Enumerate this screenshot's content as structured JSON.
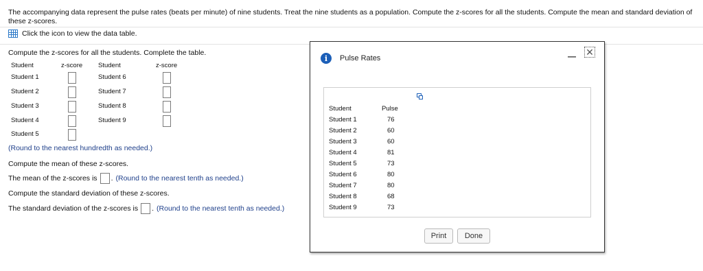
{
  "question": {
    "prompt": "The accompanying data represent the pulse rates (beats per minute) of nine students. Treat the nine students as a population. Compute the z-scores for all the students. Compute the mean and standard deviation of these z-scores.",
    "icon_link": "Click the icon to view the data table."
  },
  "part_a": {
    "instruction": "Compute the z-scores for all the students. Complete the table.",
    "headers": [
      "Student",
      "z-score",
      "Student",
      "z-score"
    ],
    "left_rows": [
      "Student 1",
      "Student 2",
      "Student 3",
      "Student 4",
      "Student 5"
    ],
    "right_rows": [
      "Student 6",
      "Student 7",
      "Student 8",
      "Student 9"
    ],
    "round_note": "(Round to the nearest hundredth as needed.)"
  },
  "part_b": {
    "instruction": "Compute the mean of these z-scores.",
    "sentence": "The mean of the z-scores is",
    "round_note": "(Round to the nearest tenth as needed.)"
  },
  "part_c": {
    "instruction": "Compute the standard deviation of these z-scores.",
    "sentence": "The standard deviation of the z-scores is",
    "round_note": "(Round to the nearest tenth as needed.)"
  },
  "modal": {
    "title": "Pulse Rates",
    "info_glyph": "i",
    "minimize_glyph": "—",
    "close_glyph": "✕",
    "table": {
      "headers": [
        "Student",
        "Pulse"
      ],
      "rows": [
        [
          "Student 1",
          "76"
        ],
        [
          "Student 2",
          "60"
        ],
        [
          "Student 3",
          "60"
        ],
        [
          "Student 4",
          "81"
        ],
        [
          "Student 5",
          "73"
        ],
        [
          "Student 6",
          "80"
        ],
        [
          "Student 7",
          "80"
        ],
        [
          "Student 8",
          "68"
        ],
        [
          "Student 9",
          "73"
        ]
      ]
    },
    "print_label": "Print",
    "done_label": "Done"
  },
  "colors": {
    "accent_blue": "#1c5fb8",
    "note_blue": "#1e3f8a"
  }
}
